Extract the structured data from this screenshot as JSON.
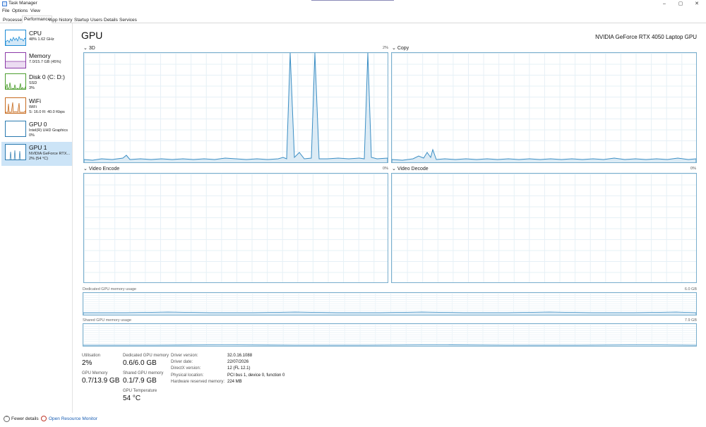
{
  "window": {
    "title": "Task Manager",
    "controls": {
      "minimize": "–",
      "restore": "▢",
      "close": "✕"
    }
  },
  "menu": [
    "File",
    "Options",
    "View"
  ],
  "tabs": [
    "Processes",
    "Performance",
    "App history",
    "Startup",
    "Users",
    "Details",
    "Services"
  ],
  "active_tab": "Performance",
  "sidebar": {
    "items": [
      {
        "title": "CPU",
        "line1": "48%  1.62 GHz",
        "line2": "",
        "color": "#1f8dd6"
      },
      {
        "title": "Memory",
        "line1": "7.0/15.7 GB (45%)",
        "line2": "",
        "color": "#8b3aa8"
      },
      {
        "title": "Disk 0 (C: D:)",
        "line1": "SSD",
        "line2": "3%",
        "color": "#4d9e2f"
      },
      {
        "title": "WiFi",
        "line1": "WiFi",
        "line2": "S: 16.0  R: 40.0 Kbps",
        "color": "#c76b1f"
      },
      {
        "title": "GPU 0",
        "line1": "Intel(R) UHD Graphics",
        "line2": "0%",
        "color": "#2a7ab0"
      },
      {
        "title": "GPU 1",
        "line1": "NVIDIA GeForce RTX...",
        "line2": "2% (54 °C)",
        "color": "#2a7ab0"
      }
    ],
    "selected_index": 5
  },
  "main": {
    "title": "GPU",
    "device_name": "NVIDIA GeForce RTX 4050 Laptop GPU",
    "graphs": [
      {
        "label": "3D",
        "pct": "2%"
      },
      {
        "label": "Copy",
        "pct": ""
      },
      {
        "label": "Video Encode",
        "pct": "0%"
      },
      {
        "label": "Video Decode",
        "pct": "0%"
      }
    ],
    "dedicated_memory": {
      "label": "Dedicated GPU memory usage",
      "max": "6.0 GB"
    },
    "shared_memory": {
      "label": "Shared GPU memory usage",
      "max": "7.9 GB"
    }
  },
  "stats": {
    "utilisation": {
      "label": "Utilisation",
      "value": "2%"
    },
    "dedicated": {
      "label": "Dedicated GPU memory",
      "value": "0.6/6.0 GB"
    },
    "gpu_memory": {
      "label": "GPU Memory",
      "value": "0.7/13.9 GB"
    },
    "shared": {
      "label": "Shared GPU memory",
      "value": "0.1/7.9 GB"
    },
    "temperature": {
      "label": "GPU Temperature",
      "value": "54 °C"
    }
  },
  "info": [
    {
      "key": "Driver version:",
      "value": "32.0.16.1088"
    },
    {
      "key": "Driver date:",
      "value": "22/07/2026"
    },
    {
      "key": "DirectX version:",
      "value": "12 (FL 12.1)"
    },
    {
      "key": "Physical location:",
      "value": "PCI bus 1, device 0, function 0"
    },
    {
      "key": "Hardware reserved memory:",
      "value": "224 MB"
    }
  ],
  "footer": {
    "fewer_details": "Fewer details",
    "open_resource_monitor": "Open Resource Monitor"
  },
  "colors": {
    "graph_border": "#79aecd",
    "graph_line": "#3b8ec4",
    "graph_fill": "#dcebf5",
    "selected_bg": "#cce4f7",
    "link": "#1a5fb4"
  }
}
